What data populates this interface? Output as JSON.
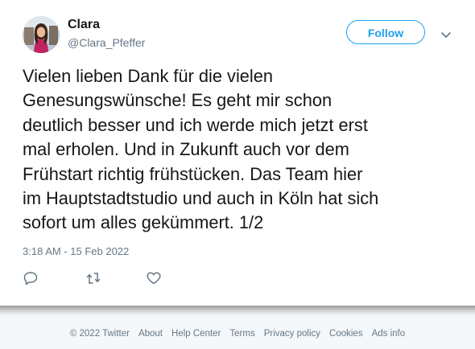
{
  "user": {
    "name": "Clara",
    "handle": "@Clara_Pfeffer",
    "avatar_icon": "profile-photo"
  },
  "follow_button": {
    "label": "Follow",
    "color": "#1da1f2"
  },
  "tweet": {
    "text": "Vielen lieben Dank für die vielen\nGenesungswünsche! Es geht mir schon\ndeutlich besser und ich werde mich jetzt erst\nmal erholen. Und in Zukunft auch vor dem\nFrühstart richtig frühstücken. Das Team hier\nim Hauptstadtstudio und auch in Köln hat sich\nsofort um alles gekümmert. 1/2",
    "timestamp": "3:18 AM - 15 Feb 2022"
  },
  "actions": {
    "icons": [
      "reply-icon",
      "retweet-icon",
      "like-icon"
    ]
  },
  "footer": {
    "copyright": "© 2022 Twitter",
    "links": [
      "About",
      "Help Center",
      "Terms",
      "Privacy policy",
      "Cookies",
      "Ads info"
    ]
  },
  "colors": {
    "text": "#14171a",
    "secondary": "#657786",
    "accent": "#1da1f2",
    "footer_bg": "#f5f8fa"
  }
}
